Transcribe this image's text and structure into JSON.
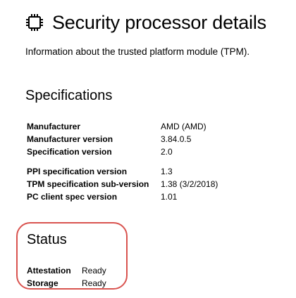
{
  "header": {
    "icon": "chip-icon",
    "title": "Security processor details",
    "subtitle": "Information about the trusted platform module (TPM)."
  },
  "specifications": {
    "heading": "Specifications",
    "group1": [
      {
        "label": "Manufacturer",
        "value": "AMD (AMD)"
      },
      {
        "label": "Manufacturer version",
        "value": "3.84.0.5"
      },
      {
        "label": "Specification version",
        "value": "2.0"
      }
    ],
    "group2": [
      {
        "label": "PPI specification version",
        "value": "1.3"
      },
      {
        "label": "TPM specification sub-version",
        "value": "1.38 (3/2/2018)"
      },
      {
        "label": "PC client spec version",
        "value": "1.01"
      }
    ]
  },
  "status": {
    "heading": "Status",
    "highlight_color": "#d9534f",
    "items": [
      {
        "label": "Attestation",
        "value": "Ready"
      },
      {
        "label": "Storage",
        "value": "Ready"
      }
    ]
  }
}
